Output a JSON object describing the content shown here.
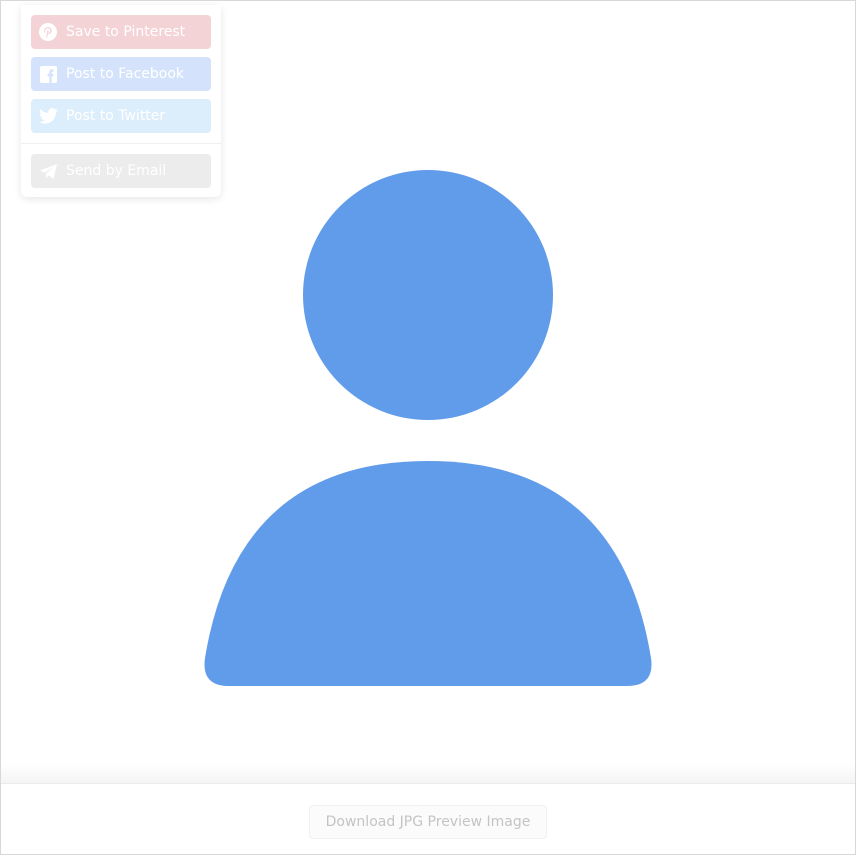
{
  "share_menu": {
    "pinterest_label": "Save to Pinterest",
    "facebook_label": "Post to Facebook",
    "twitter_label": "Post to Twitter",
    "email_label": "Send by Email"
  },
  "avatar": {
    "icon": "user-icon",
    "color": "#619cea"
  },
  "footer": {
    "download_label": "Download JPG Preview Image"
  },
  "colors": {
    "pinterest": "#f4d3d6",
    "facebook": "#d4e3fb",
    "twitter": "#dceefb",
    "email": "#ececec"
  }
}
